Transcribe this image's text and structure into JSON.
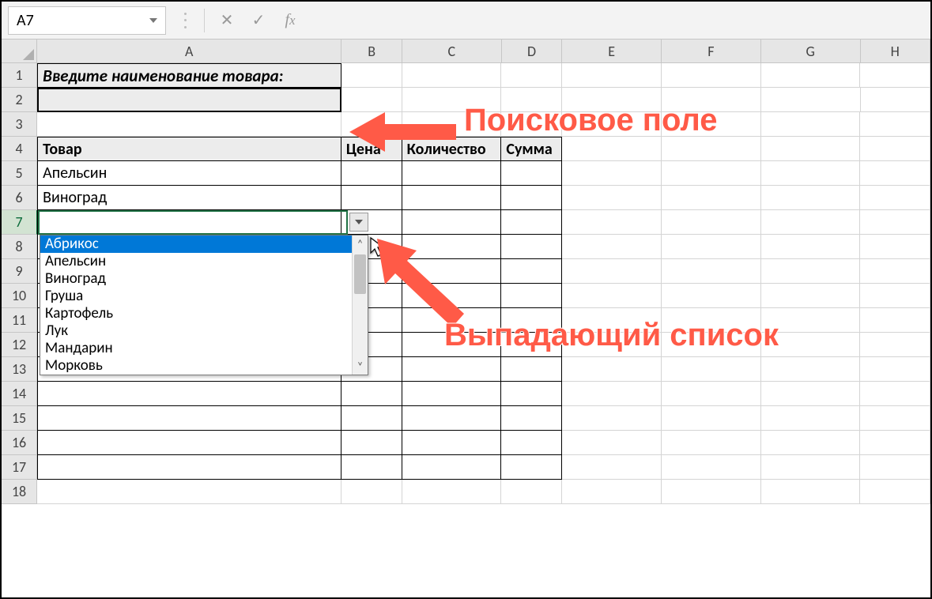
{
  "namebox": "A7",
  "columns": [
    "A",
    "B",
    "C",
    "D",
    "E",
    "F",
    "G",
    "H"
  ],
  "row_numbers": [
    1,
    2,
    3,
    4,
    5,
    6,
    7,
    8,
    9,
    10,
    11,
    12,
    13,
    14,
    15,
    16,
    17,
    18
  ],
  "cells": {
    "A1": "Введите наименование товара:",
    "A4": "Товар",
    "B4": "Цена",
    "C4": "Количество",
    "D4": "Сумма",
    "A5": "Апельсин",
    "A6": "Виноград"
  },
  "dropdown": {
    "items": [
      "Абрикос",
      "Апельсин",
      "Виноград",
      "Груша",
      "Картофель",
      "Лук",
      "Мандарин",
      "Морковь"
    ],
    "selected_index": 0
  },
  "annotations": {
    "label1": "Поисковое поле",
    "label2": "Выпадающий список"
  }
}
